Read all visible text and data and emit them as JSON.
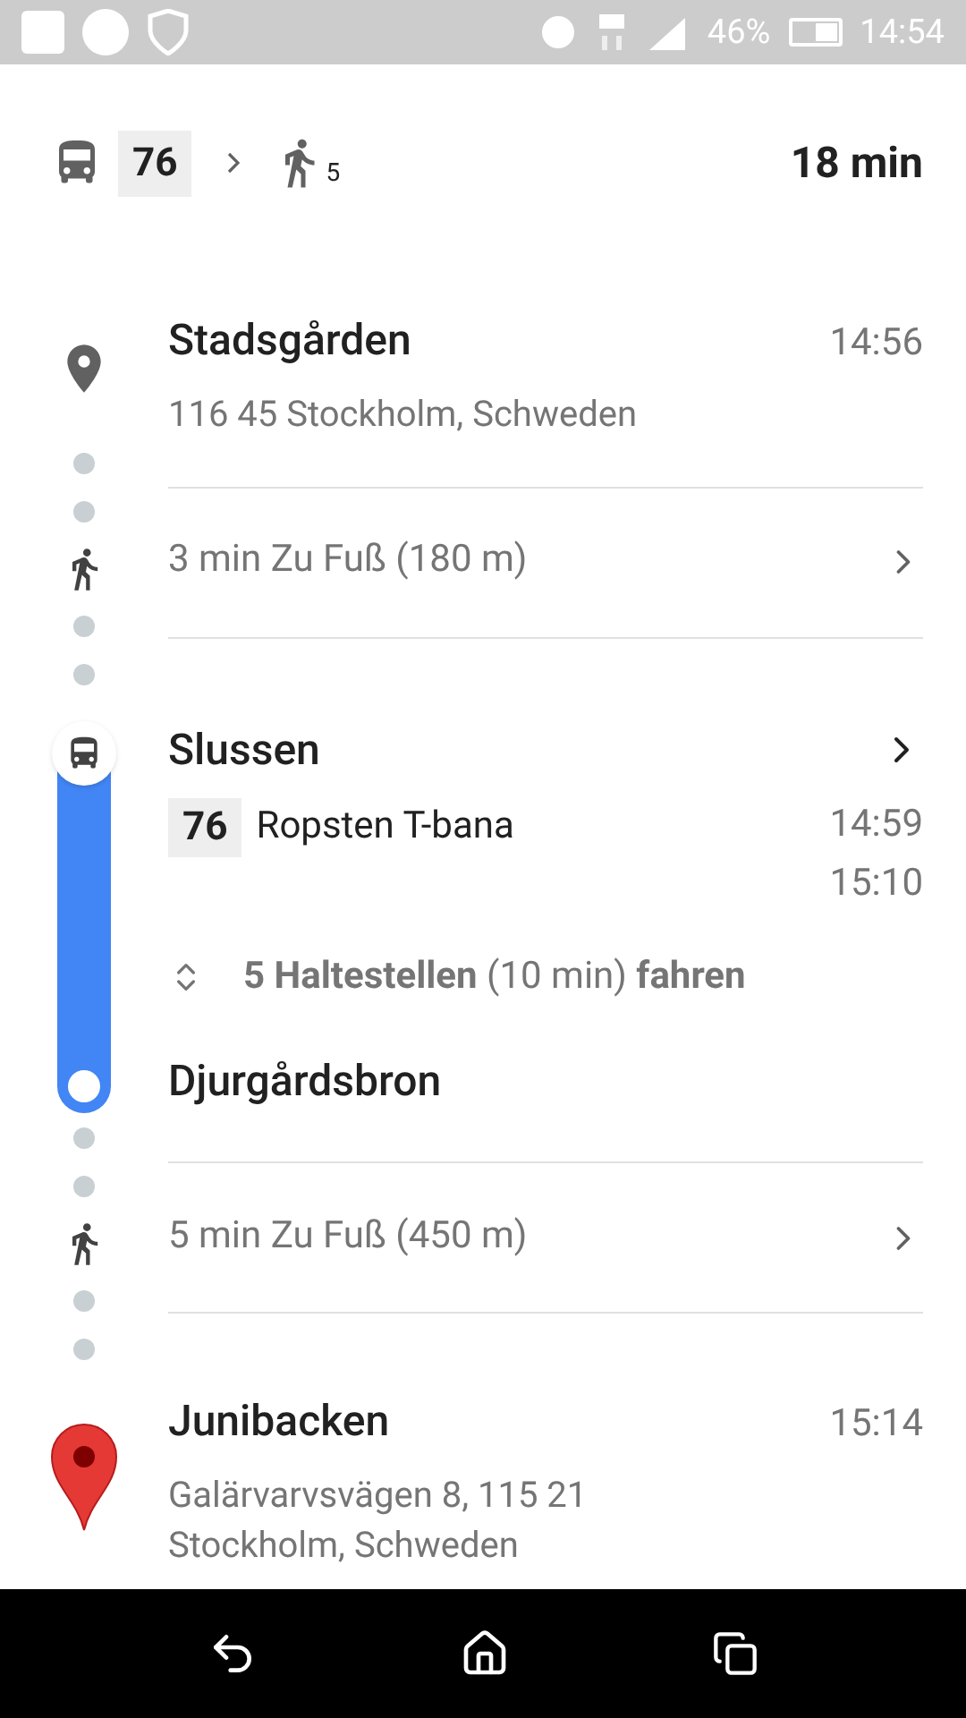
{
  "status_bar": {
    "battery": "46%",
    "time": "14:54"
  },
  "summary": {
    "bus_line": "76",
    "walk_minutes": "5",
    "duration": "18 min"
  },
  "steps": [
    {
      "kind": "place",
      "name": "Stadsgården",
      "address": "116 45 Stockholm, Schweden",
      "time": "14:56"
    },
    {
      "kind": "walk",
      "text": "3 min Zu Fuß (180 m)"
    },
    {
      "kind": "transit",
      "name": "Slussen",
      "line": "76",
      "headsign": "Ropsten T-bana",
      "depart": "14:59",
      "arrive": "15:10",
      "stops": "**5 Haltestellen** (10 min) **fahren**",
      "end_stop": "Djurgårdsbron"
    },
    {
      "kind": "walk",
      "text": "5 min Zu Fuß (450 m)"
    },
    {
      "kind": "destination",
      "name": "Junibacken",
      "address": "Galärvarvsvägen 8, 115 21 Stockholm, Schweden",
      "time": "15:14"
    }
  ]
}
